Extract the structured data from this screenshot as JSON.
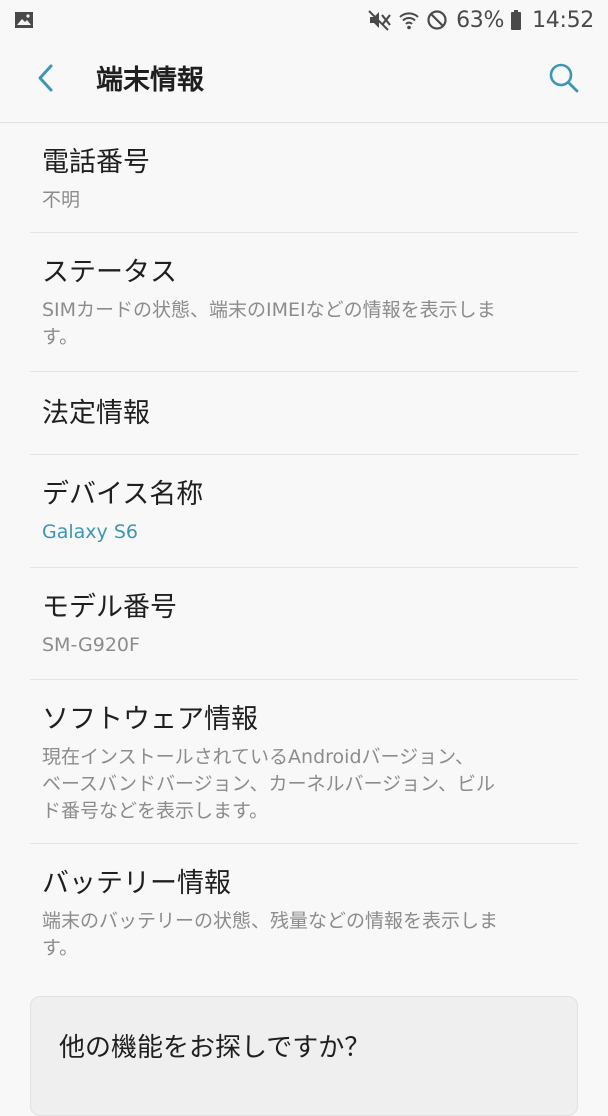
{
  "status_bar": {
    "notification_icon": "image-icon",
    "icons": [
      "mute-icon",
      "wifi-icon",
      "do-not-disturb-icon",
      "battery-icon"
    ],
    "battery": "63%",
    "time": "14:52"
  },
  "app_bar": {
    "back_icon": "back-arrow-icon",
    "title": "端末情報",
    "search_icon": "search-icon"
  },
  "items": [
    {
      "title": "電話番号",
      "subtitle": "不明"
    },
    {
      "title": "ステータス",
      "subtitle_lines": [
        "SIMカードの状態、端末のIMEIなどの情報を表示しま",
        "す。"
      ]
    },
    {
      "title": "法定情報"
    },
    {
      "title": "デバイス名称",
      "subtitle": "Galaxy S6"
    },
    {
      "title": "モデル番号",
      "subtitle": "SM-G920F"
    },
    {
      "title": "ソフトウェア情報",
      "subtitle_lines": [
        "現在インストールされているAndroidバージョン、",
        "ベースバンドバージョン、カーネルバージョン、ビル",
        "ド番号などを表示します。"
      ]
    },
    {
      "title": "バッテリー情報",
      "subtitle_lines": [
        "端末のバッテリーの状態、残量などの情報を表示しま",
        "す。"
      ]
    }
  ],
  "suggestion": {
    "title": "他の機能をお探しですか？"
  },
  "colors": {
    "accent": "#3d96b4",
    "background": "#f8f8f8",
    "subtitle": "#8c8c8c"
  }
}
